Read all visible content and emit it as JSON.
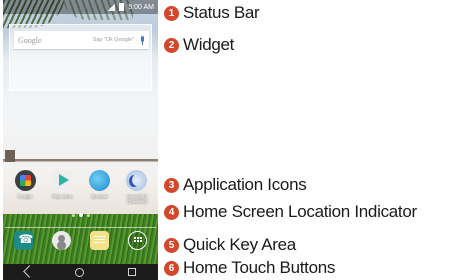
{
  "phone": {
    "status_bar": {
      "time": "5:00 AM"
    },
    "widget": {
      "search_logo": "Google",
      "search_hint": "Say \"Ok Google\""
    },
    "apps": [
      {
        "label": "Google",
        "icon": "google-folder-icon"
      },
      {
        "label": "Play Store",
        "icon": "play-store-icon"
      },
      {
        "label": "Browser",
        "icon": "browser-globe-icon"
      },
      {
        "label": "Moonlight Download",
        "icon": "moon-app-icon"
      }
    ],
    "page_indicator": {
      "pages": 3,
      "active": 2
    },
    "quick_keys": [
      "phone-icon",
      "contacts-icon",
      "messages-icon",
      "apps-drawer-icon"
    ],
    "nav_buttons": [
      "back-icon",
      "home-icon",
      "recent-apps-icon"
    ]
  },
  "callouts": [
    {
      "num": "1",
      "label": "Status Bar"
    },
    {
      "num": "2",
      "label": "Widget"
    },
    {
      "num": "3",
      "label": "Application Icons"
    },
    {
      "num": "4",
      "label": "Home Screen Location Indicator"
    },
    {
      "num": "5",
      "label": "Quick Key Area"
    },
    {
      "num": "6",
      "label": "Home Touch Buttons"
    }
  ],
  "colors": {
    "callout_badge": "#d4472a",
    "nav_bar": "#1b1b1b"
  }
}
